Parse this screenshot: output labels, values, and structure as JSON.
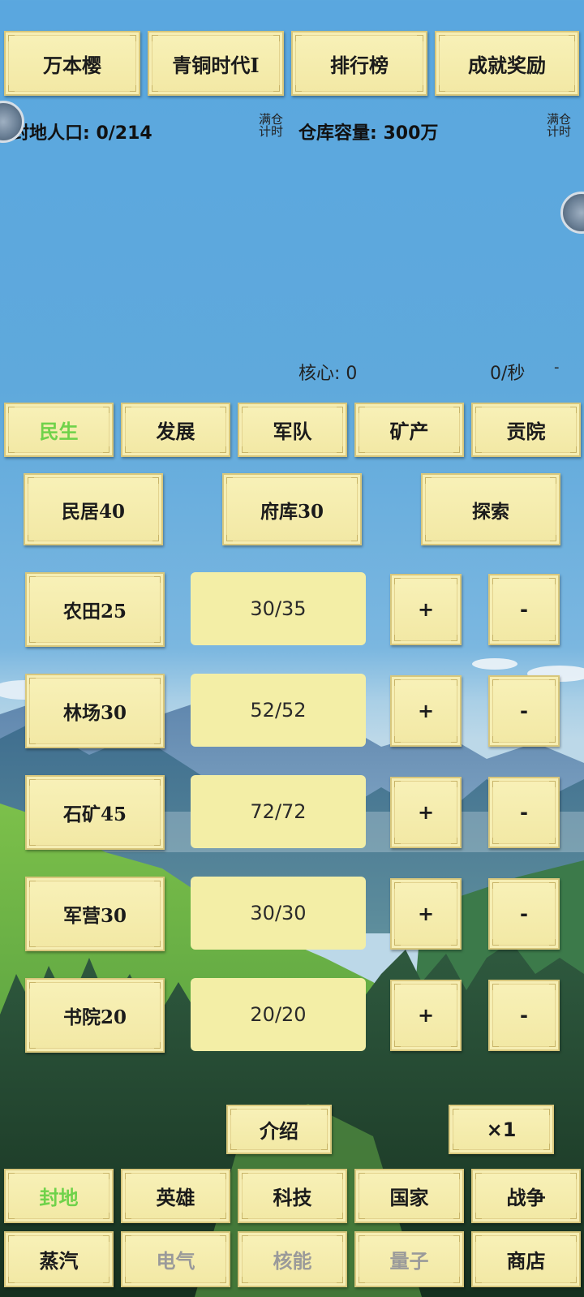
{
  "top_tabs": [
    "万本樱",
    "青铜时代Ⅰ",
    "排行榜",
    "成就奖励"
  ],
  "stats": {
    "population": "封地人口: 0/214",
    "full_timer_label_1": "满仓",
    "full_timer_label_2": "计时",
    "warehouse": "仓库容量: 300万",
    "full_timer_right_1": "满仓",
    "full_timer_right_2": "计时"
  },
  "core": {
    "label": "核心: 0",
    "rate": "0/秒",
    "dash": "-"
  },
  "category_tabs": [
    {
      "label": "民生",
      "active": true
    },
    {
      "label": "发展",
      "active": false
    },
    {
      "label": "军队",
      "active": false
    },
    {
      "label": "矿产",
      "active": false
    },
    {
      "label": "贡院",
      "active": false
    }
  ],
  "quick_buttons": [
    "民居40",
    "府库30",
    "探索"
  ],
  "buildings": [
    {
      "name": "农田25",
      "count": "30/35",
      "plus": "+",
      "minus": "-"
    },
    {
      "name": "林场30",
      "count": "52/52",
      "plus": "+",
      "minus": "-"
    },
    {
      "name": "石矿45",
      "count": "72/72",
      "plus": "+",
      "minus": "-"
    },
    {
      "name": "军营30",
      "count": "30/30",
      "plus": "+",
      "minus": "-"
    },
    {
      "name": "书院20",
      "count": "20/20",
      "plus": "+",
      "minus": "-"
    }
  ],
  "footer_actions": {
    "intro": "介绍",
    "speed": "×1"
  },
  "nav_row1": [
    {
      "label": "封地",
      "state": "active"
    },
    {
      "label": "英雄",
      "state": "normal"
    },
    {
      "label": "科技",
      "state": "normal"
    },
    {
      "label": "国家",
      "state": "normal"
    },
    {
      "label": "战争",
      "state": "normal"
    }
  ],
  "nav_row2": [
    {
      "label": "蒸汽",
      "state": "normal"
    },
    {
      "label": "电气",
      "state": "disabled"
    },
    {
      "label": "核能",
      "state": "disabled"
    },
    {
      "label": "量子",
      "state": "disabled"
    },
    {
      "label": "商店",
      "state": "normal"
    }
  ],
  "colors": {
    "active_text": "#6fd24a",
    "disabled_text": "#9a9a9a",
    "sky": "#5aa7df",
    "parchment": "#f3eea6"
  }
}
